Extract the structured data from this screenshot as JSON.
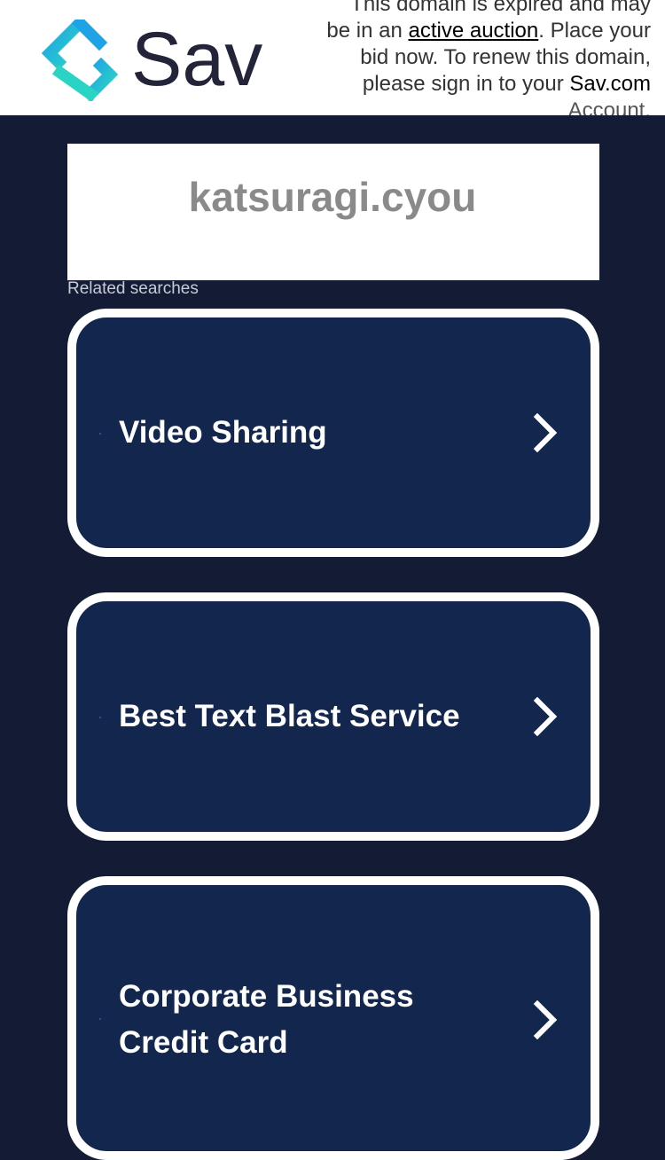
{
  "header": {
    "logo_text": "Sav",
    "notice": {
      "part1": "This domain is expired and may be in an ",
      "link_auction": "active auction",
      "part2": ". Place your bid now. To renew this domain, please sign in to your ",
      "link_account_site": "Sav.com",
      "part3": " Account."
    }
  },
  "domain": {
    "name": "katsuragi.cyou"
  },
  "related": {
    "label": "Related searches",
    "items": [
      {
        "label": "Video Sharing",
        "icon": "chevron-right-icon"
      },
      {
        "label": "Best Text Blast Service",
        "icon": "chevron-right-icon"
      },
      {
        "label": "Corporate Business Credit Card",
        "icon": "chevron-right-icon"
      }
    ]
  },
  "colors": {
    "background": "#131b35",
    "card_fill": "#13264d",
    "card_border": "#ffffff",
    "logo_teal": "#2ad4c4",
    "logo_blue": "#1fa3e6",
    "logo_text": "#23243a"
  }
}
